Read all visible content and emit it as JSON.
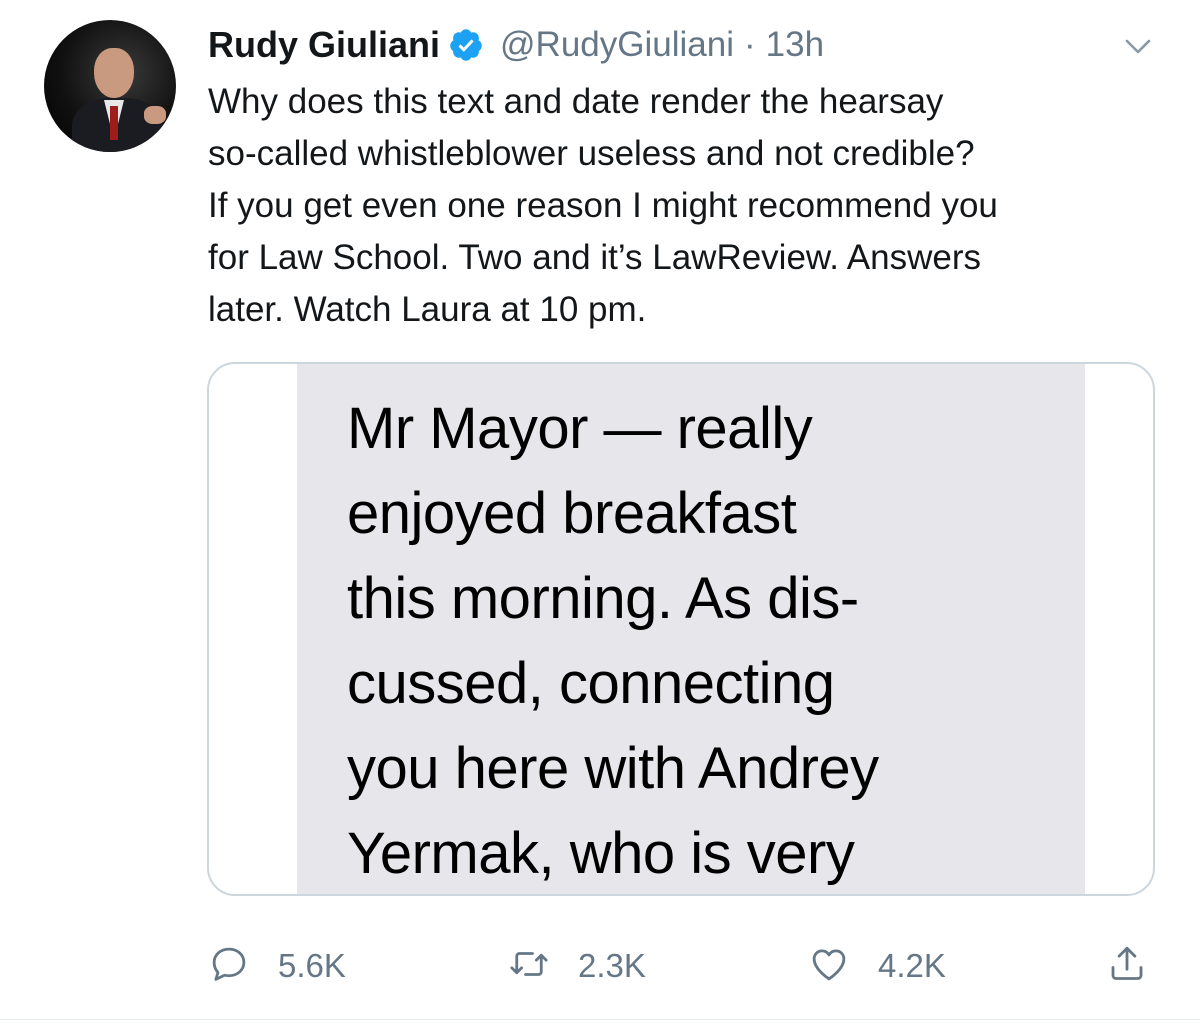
{
  "author": {
    "name": "Rudy Giuliani",
    "handle": "@RudyGiuliani",
    "separator": "·",
    "time": "13h",
    "verified": true
  },
  "tweet": {
    "text": "Why does this text and date render the hearsay\nso-called whistleblower useless and not credible?\nIf you get even one reason I might recommend you\nfor Law School. Two and it’s LawReview. Answers\nlater. Watch Laura at 10 pm."
  },
  "media": {
    "message_text": "Mr Mayor — really\nenjoyed breakfast\nthis morning. As dis-\ncussed, connecting\nyou here with Andrey\nYermak, who is very"
  },
  "actions": {
    "reply_count": "5.6K",
    "retweet_count": "2.3K",
    "like_count": "4.2K"
  },
  "icons": {
    "verified": "verified-badge-icon",
    "more": "chevron-down-icon",
    "reply": "reply-icon",
    "retweet": "retweet-icon",
    "like": "heart-icon",
    "share": "share-icon"
  },
  "colors": {
    "accent": "#1da1f2",
    "secondary_text": "#657786",
    "bubble": "#e6e6eb"
  }
}
